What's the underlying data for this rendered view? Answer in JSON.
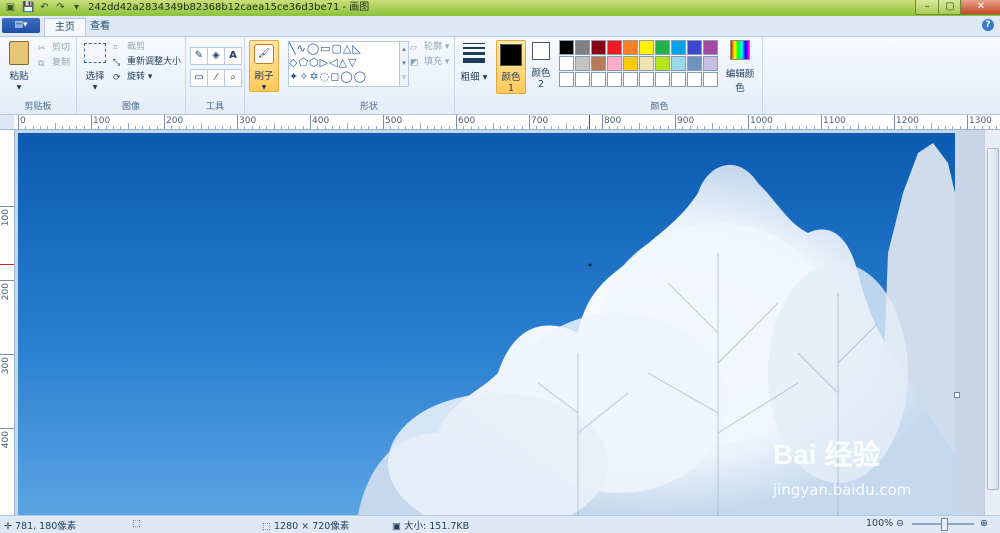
{
  "window": {
    "title": "242dd42a2834349b82368b12caea15ce36d3be71 - 画图",
    "minimize": "–",
    "maximize": "▢",
    "close": "✕"
  },
  "quick_access": [
    "save-icon",
    "undo-icon",
    "redo-icon",
    "customize-icon"
  ],
  "app_menu": "▤▾",
  "tabs": [
    {
      "label": "主页",
      "active": true
    },
    {
      "label": "查看",
      "active": false
    }
  ],
  "ribbon": {
    "clipboard": {
      "label": "剪贴板",
      "paste": "粘贴",
      "cut": "剪切",
      "copy": "复制"
    },
    "image": {
      "label": "图像",
      "select": "选择",
      "crop": "裁剪",
      "resize": "重新调整大小",
      "rotate": "旋转"
    },
    "tools": {
      "label": "工具",
      "icons": [
        "pencil-icon",
        "fill-icon",
        "text-icon",
        "eraser-icon",
        "color-picker-icon",
        "magnifier-icon"
      ]
    },
    "brushes": {
      "label": "刷子"
    },
    "shapes": {
      "label": "形状",
      "outline": "轮廓",
      "fill": "填充"
    },
    "size": {
      "label": "粗细"
    },
    "color1": {
      "label": "颜色 1",
      "value": "#000000"
    },
    "color2": {
      "label": "颜色 2",
      "value": "#ffffff"
    },
    "colors": {
      "label": "颜色",
      "edit": "编辑颜色",
      "row1": [
        "#000000",
        "#7f7f7f",
        "#880015",
        "#ed1c24",
        "#ff7f27",
        "#fff200",
        "#22b14c",
        "#00a2e8",
        "#3f48cc",
        "#a349a4"
      ],
      "row2": [
        "#ffffff",
        "#c3c3c3",
        "#b97a57",
        "#ffaec9",
        "#ffc90e",
        "#efe4b0",
        "#b5e61d",
        "#99d9ea",
        "#7092be",
        "#c8bfe7"
      ],
      "row3": [
        "#ffffff",
        "#ffffff",
        "#ffffff",
        "#ffffff",
        "#ffffff",
        "#ffffff",
        "#ffffff",
        "#ffffff",
        "#ffffff",
        "#ffffff"
      ]
    }
  },
  "ruler": {
    "h_labels": [
      "0",
      "100",
      "200",
      "300",
      "400",
      "500",
      "600",
      "700",
      "800",
      "900",
      "1000",
      "1100",
      "1200",
      "1300"
    ],
    "v_labels": [
      "100",
      "200",
      "300",
      "400"
    ]
  },
  "canvas": {
    "watermark_brand": "Bai 经验",
    "watermark_url": "jingyan.baidu.com"
  },
  "status": {
    "cursor": "781, 180像素",
    "dimensions": "1280 × 720像素",
    "size": "大小: 151.7KB",
    "zoom": "100%"
  }
}
